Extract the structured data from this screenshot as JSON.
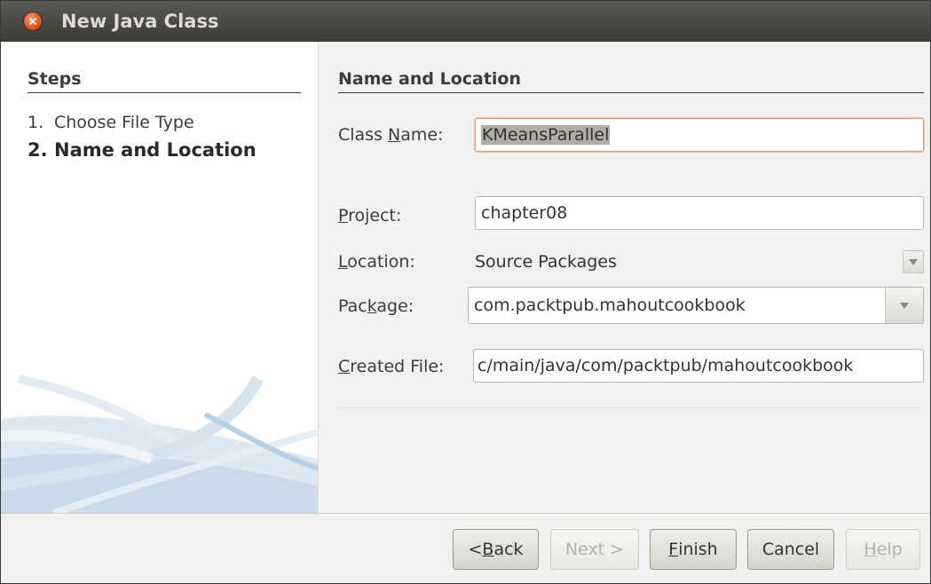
{
  "window": {
    "title": "New Java Class"
  },
  "steps": {
    "heading": "Steps",
    "items": [
      {
        "num": "1.",
        "label": "Choose File Type",
        "current": false
      },
      {
        "num": "2.",
        "label": "Name and Location",
        "current": true
      }
    ]
  },
  "form": {
    "heading": "Name and Location",
    "class_name": {
      "label_pre": "Class ",
      "label_key": "N",
      "label_post": "ame:",
      "value": "KMeansParallel"
    },
    "project": {
      "label_pre": "",
      "label_key": "P",
      "label_post": "roject:",
      "value": "chapter08"
    },
    "location": {
      "label_pre": "",
      "label_key": "L",
      "label_post": "ocation:",
      "value": "Source Packages"
    },
    "package": {
      "label_pre": "Pac",
      "label_key": "k",
      "label_post": "age:",
      "value": "com.packtpub.mahoutcookbook"
    },
    "created_file": {
      "label_pre": "",
      "label_key": "C",
      "label_post": "reated File:",
      "value": "c/main/java/com/packtpub/mahoutcookbook"
    }
  },
  "buttons": {
    "back": {
      "pre": "< ",
      "key": "B",
      "post": "ack"
    },
    "next": {
      "label": "Next >"
    },
    "finish": {
      "pre": "",
      "key": "F",
      "post": "inish"
    },
    "cancel": {
      "label": "Cancel"
    },
    "help": {
      "pre": "",
      "key": "H",
      "post": "elp"
    }
  },
  "icons": {
    "close": "close-icon",
    "dropdown": "chevron-down-icon"
  },
  "colors": {
    "titlebar": "#3c3b37",
    "close_button": "#e3531f",
    "focus_border": "#e59572"
  }
}
